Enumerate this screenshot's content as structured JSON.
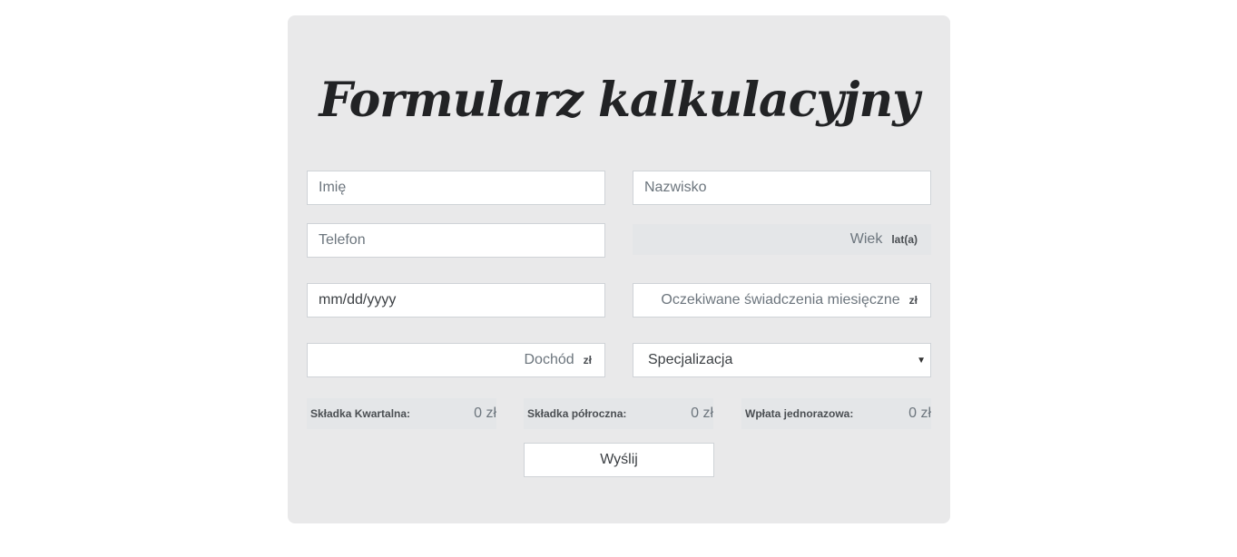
{
  "form": {
    "title": "Formularz kalkulacyjny",
    "first_name": {
      "placeholder": "Imię"
    },
    "last_name": {
      "placeholder": "Nazwisko"
    },
    "phone": {
      "placeholder": "Telefon"
    },
    "age": {
      "placeholder": "Wiek",
      "unit": "lat(a)"
    },
    "birth_date": {
      "value": "mm/dd/yyyy"
    },
    "expected_benefit": {
      "placeholder": "Oczekiwane świadczenia miesięczne",
      "unit": "zł"
    },
    "income": {
      "placeholder": "Dochód",
      "unit": "zł"
    },
    "specialization": {
      "selected": "Specjalizacja"
    },
    "summary": [
      {
        "label": "Składka Kwartalna:",
        "value": "0 zł"
      },
      {
        "label": "Składka półroczna:",
        "value": "0 zł"
      },
      {
        "label": "Wpłata jednorazowa:",
        "value": "0 zł"
      }
    ],
    "submit_label": "Wyślij"
  },
  "colors": {
    "card_background": "#e9e9ea",
    "title_color": "#222325",
    "placeholder_color": "#6c757d"
  }
}
